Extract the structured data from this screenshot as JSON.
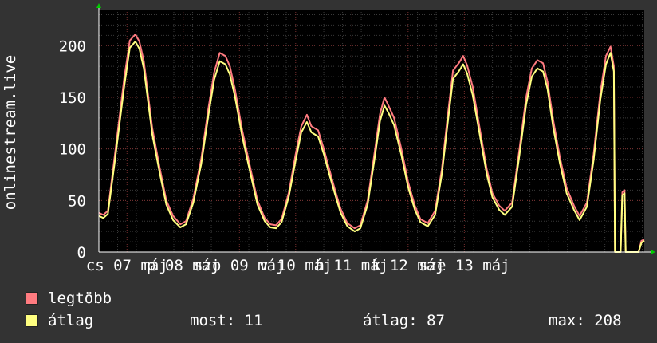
{
  "chart_data": {
    "type": "line",
    "ylabel": "onlinestream.live",
    "ylim": [
      0,
      235
    ],
    "yticks": [
      0,
      50,
      100,
      150,
      200
    ],
    "xticks": [
      "cs 07 máj",
      "p 08 máj",
      "szo 09 máj",
      "v 10 máj",
      "h 11 máj",
      "k 12 máj",
      "sze 13 máj"
    ],
    "grid": true,
    "series": [
      {
        "name": "legtöbb",
        "color": "#ff7b80",
        "points": [
          [
            0,
            38
          ],
          [
            0.08,
            36
          ],
          [
            0.16,
            40
          ],
          [
            0.28,
            92
          ],
          [
            0.45,
            168
          ],
          [
            0.55,
            205
          ],
          [
            0.65,
            211
          ],
          [
            0.72,
            204
          ],
          [
            0.8,
            185
          ],
          [
            0.95,
            120
          ],
          [
            1.08,
            82
          ],
          [
            1.2,
            50
          ],
          [
            1.32,
            35
          ],
          [
            1.45,
            27
          ],
          [
            1.55,
            30
          ],
          [
            1.68,
            52
          ],
          [
            1.82,
            90
          ],
          [
            1.95,
            140
          ],
          [
            2.05,
            174
          ],
          [
            2.15,
            193
          ],
          [
            2.25,
            190
          ],
          [
            2.33,
            180
          ],
          [
            2.42,
            158
          ],
          [
            2.55,
            118
          ],
          [
            2.7,
            80
          ],
          [
            2.82,
            50
          ],
          [
            2.95,
            33
          ],
          [
            3.05,
            27
          ],
          [
            3.15,
            26
          ],
          [
            3.25,
            32
          ],
          [
            3.38,
            58
          ],
          [
            3.5,
            95
          ],
          [
            3.6,
            122
          ],
          [
            3.7,
            133
          ],
          [
            3.78,
            122
          ],
          [
            3.9,
            118
          ],
          [
            4.0,
            100
          ],
          [
            4.1,
            80
          ],
          [
            4.2,
            60
          ],
          [
            4.3,
            42
          ],
          [
            4.42,
            28
          ],
          [
            4.55,
            23
          ],
          [
            4.65,
            26
          ],
          [
            4.78,
            50
          ],
          [
            4.9,
            95
          ],
          [
            5.0,
            134
          ],
          [
            5.08,
            150
          ],
          [
            5.15,
            142
          ],
          [
            5.25,
            130
          ],
          [
            5.38,
            100
          ],
          [
            5.5,
            68
          ],
          [
            5.62,
            45
          ],
          [
            5.72,
            32
          ],
          [
            5.85,
            28
          ],
          [
            5.98,
            40
          ],
          [
            6.1,
            80
          ],
          [
            6.2,
            130
          ],
          [
            6.3,
            176
          ],
          [
            6.4,
            183
          ],
          [
            6.48,
            190
          ],
          [
            6.55,
            181
          ],
          [
            6.65,
            160
          ],
          [
            6.78,
            118
          ],
          [
            6.9,
            80
          ],
          [
            7.0,
            57
          ],
          [
            7.12,
            45
          ],
          [
            7.22,
            40
          ],
          [
            7.35,
            48
          ],
          [
            7.48,
            100
          ],
          [
            7.6,
            150
          ],
          [
            7.7,
            178
          ],
          [
            7.8,
            186
          ],
          [
            7.9,
            183
          ],
          [
            7.98,
            165
          ],
          [
            8.08,
            128
          ],
          [
            8.2,
            92
          ],
          [
            8.32,
            62
          ],
          [
            8.45,
            45
          ],
          [
            8.55,
            35
          ],
          [
            8.68,
            48
          ],
          [
            8.8,
            95
          ],
          [
            8.92,
            155
          ],
          [
            9.02,
            190
          ],
          [
            9.1,
            199
          ],
          [
            9.16,
            180
          ],
          [
            9.18,
            0
          ],
          [
            9.28,
            0
          ],
          [
            9.31,
            58
          ],
          [
            9.35,
            60
          ],
          [
            9.37,
            0
          ],
          [
            9.6,
            0
          ],
          [
            9.65,
            11
          ],
          [
            9.7,
            12
          ]
        ]
      },
      {
        "name": "átlag",
        "color": "#ffff80",
        "points": [
          [
            0,
            35
          ],
          [
            0.08,
            33
          ],
          [
            0.16,
            37
          ],
          [
            0.28,
            86
          ],
          [
            0.45,
            160
          ],
          [
            0.55,
            198
          ],
          [
            0.65,
            204
          ],
          [
            0.72,
            197
          ],
          [
            0.8,
            178
          ],
          [
            0.95,
            114
          ],
          [
            1.08,
            77
          ],
          [
            1.2,
            46
          ],
          [
            1.32,
            31
          ],
          [
            1.45,
            24
          ],
          [
            1.55,
            27
          ],
          [
            1.68,
            48
          ],
          [
            1.82,
            85
          ],
          [
            1.95,
            133
          ],
          [
            2.05,
            167
          ],
          [
            2.15,
            185
          ],
          [
            2.25,
            182
          ],
          [
            2.33,
            172
          ],
          [
            2.42,
            151
          ],
          [
            2.55,
            112
          ],
          [
            2.7,
            75
          ],
          [
            2.82,
            46
          ],
          [
            2.95,
            30
          ],
          [
            3.05,
            24
          ],
          [
            3.15,
            23
          ],
          [
            3.25,
            29
          ],
          [
            3.38,
            54
          ],
          [
            3.5,
            89
          ],
          [
            3.6,
            116
          ],
          [
            3.7,
            126
          ],
          [
            3.78,
            116
          ],
          [
            3.9,
            112
          ],
          [
            4.0,
            95
          ],
          [
            4.1,
            75
          ],
          [
            4.2,
            56
          ],
          [
            4.3,
            38
          ],
          [
            4.42,
            25
          ],
          [
            4.55,
            20
          ],
          [
            4.65,
            23
          ],
          [
            4.78,
            46
          ],
          [
            4.9,
            89
          ],
          [
            5.0,
            127
          ],
          [
            5.08,
            142
          ],
          [
            5.15,
            135
          ],
          [
            5.25,
            123
          ],
          [
            5.38,
            94
          ],
          [
            5.5,
            63
          ],
          [
            5.62,
            41
          ],
          [
            5.72,
            29
          ],
          [
            5.85,
            25
          ],
          [
            5.98,
            36
          ],
          [
            6.1,
            75
          ],
          [
            6.2,
            123
          ],
          [
            6.3,
            168
          ],
          [
            6.4,
            175
          ],
          [
            6.48,
            182
          ],
          [
            6.55,
            173
          ],
          [
            6.65,
            152
          ],
          [
            6.78,
            112
          ],
          [
            6.9,
            75
          ],
          [
            7.0,
            53
          ],
          [
            7.12,
            41
          ],
          [
            7.22,
            36
          ],
          [
            7.35,
            44
          ],
          [
            7.48,
            94
          ],
          [
            7.6,
            143
          ],
          [
            7.7,
            170
          ],
          [
            7.8,
            178
          ],
          [
            7.9,
            175
          ],
          [
            7.98,
            158
          ],
          [
            8.08,
            121
          ],
          [
            8.2,
            86
          ],
          [
            8.32,
            57
          ],
          [
            8.45,
            41
          ],
          [
            8.55,
            31
          ],
          [
            8.68,
            44
          ],
          [
            8.8,
            89
          ],
          [
            8.92,
            148
          ],
          [
            9.02,
            182
          ],
          [
            9.1,
            193
          ],
          [
            9.16,
            175
          ],
          [
            9.18,
            0
          ],
          [
            9.28,
            0
          ],
          [
            9.31,
            55
          ],
          [
            9.35,
            57
          ],
          [
            9.37,
            0
          ],
          [
            9.6,
            0
          ],
          [
            9.65,
            9
          ],
          [
            9.7,
            11
          ]
        ]
      }
    ]
  },
  "legend": [
    {
      "label": "legtöbb",
      "color": "#ff7b80"
    },
    {
      "label": "átlag",
      "color": "#ffff80"
    }
  ],
  "stats": {
    "most": "most: 11",
    "atlag": "átlag: 87",
    "max": "max: 208"
  }
}
